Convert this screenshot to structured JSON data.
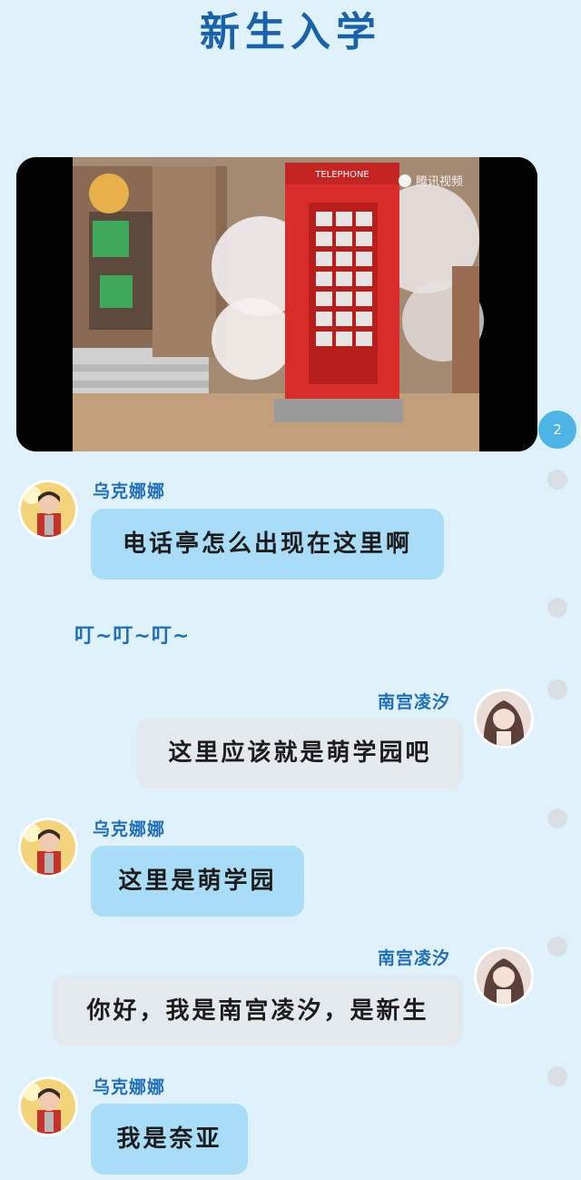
{
  "header": {
    "title": "新生入学"
  },
  "video": {
    "watermark": "腾讯视频",
    "sign_text": "TELEPHONE",
    "badge_count": "2"
  },
  "messages": [
    {
      "side": "left",
      "name": "乌克娜娜",
      "text": "电话亭怎么出现在这里啊"
    },
    {
      "side": "system",
      "text": "叮~叮~叮~"
    },
    {
      "side": "right",
      "name": "南宫凌汐",
      "text": "这里应该就是萌学园吧"
    },
    {
      "side": "left",
      "name": "乌克娜娜",
      "text": "这里是萌学园"
    },
    {
      "side": "right",
      "name": "南宫凌汐",
      "text": "你好，我是南宫凌汐，是新生"
    },
    {
      "side": "left",
      "name": "乌克娜娜",
      "text": "我是奈亚"
    }
  ],
  "colors": {
    "background": "#dff1fb",
    "title": "#1a63a8",
    "left_bubble": "#a9ddf7",
    "right_bubble": "#e4e9ee",
    "name": "#1f6fb8",
    "badge": "#4db4e6"
  }
}
